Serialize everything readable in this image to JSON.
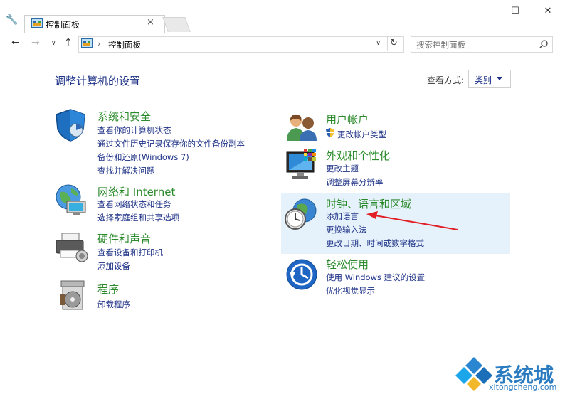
{
  "window": {
    "tab_title": "控制面板",
    "controls": {
      "minimize": "—",
      "maximize": "☐",
      "close": "✕"
    }
  },
  "address_bar": {
    "path": "控制面板",
    "search_placeholder": "搜索控制面板"
  },
  "main": {
    "heading": "调整计算机的设置",
    "view_label": "查看方式:",
    "view_value": "类别"
  },
  "categories_left": [
    {
      "title": "系统和安全",
      "icon": "shield-icon",
      "links": [
        "查看你的计算机状态",
        "通过文件历史记录保存你的文件备份副本",
        "备份和还原(Windows 7)",
        "查找并解决问题"
      ]
    },
    {
      "title": "网络和 Internet",
      "icon": "network-globe-icon",
      "links": [
        "查看网络状态和任务",
        "选择家庭组和共享选项"
      ]
    },
    {
      "title": "硬件和声音",
      "icon": "printer-icon",
      "links": [
        "查看设备和打印机",
        "添加设备"
      ]
    },
    {
      "title": "程序",
      "icon": "programs-disc-icon",
      "links": [
        "卸载程序"
      ]
    }
  ],
  "categories_right": [
    {
      "title": "用户帐户",
      "icon": "users-icon",
      "links": [
        "更改帐户类型"
      ]
    },
    {
      "title": "外观和个性化",
      "icon": "monitor-icon",
      "links": [
        "更改主题",
        "调整屏幕分辨率"
      ]
    },
    {
      "title": "时钟、语言和区域",
      "icon": "clock-globe-icon",
      "links": [
        "添加语言",
        "更换输入法",
        "更改日期、时间或数字格式"
      ]
    },
    {
      "title": "轻松使用",
      "icon": "ease-of-access-icon",
      "links": [
        "使用 Windows 建议的设置",
        "优化视觉显示"
      ]
    }
  ],
  "watermark": {
    "brand": "系统城",
    "domain": "xitongcheng.com"
  },
  "colors": {
    "title_green": "#2b8a2b",
    "link_blue": "#1e3287",
    "highlight": "#e5f1fb",
    "arrow_red": "#e31f26"
  }
}
